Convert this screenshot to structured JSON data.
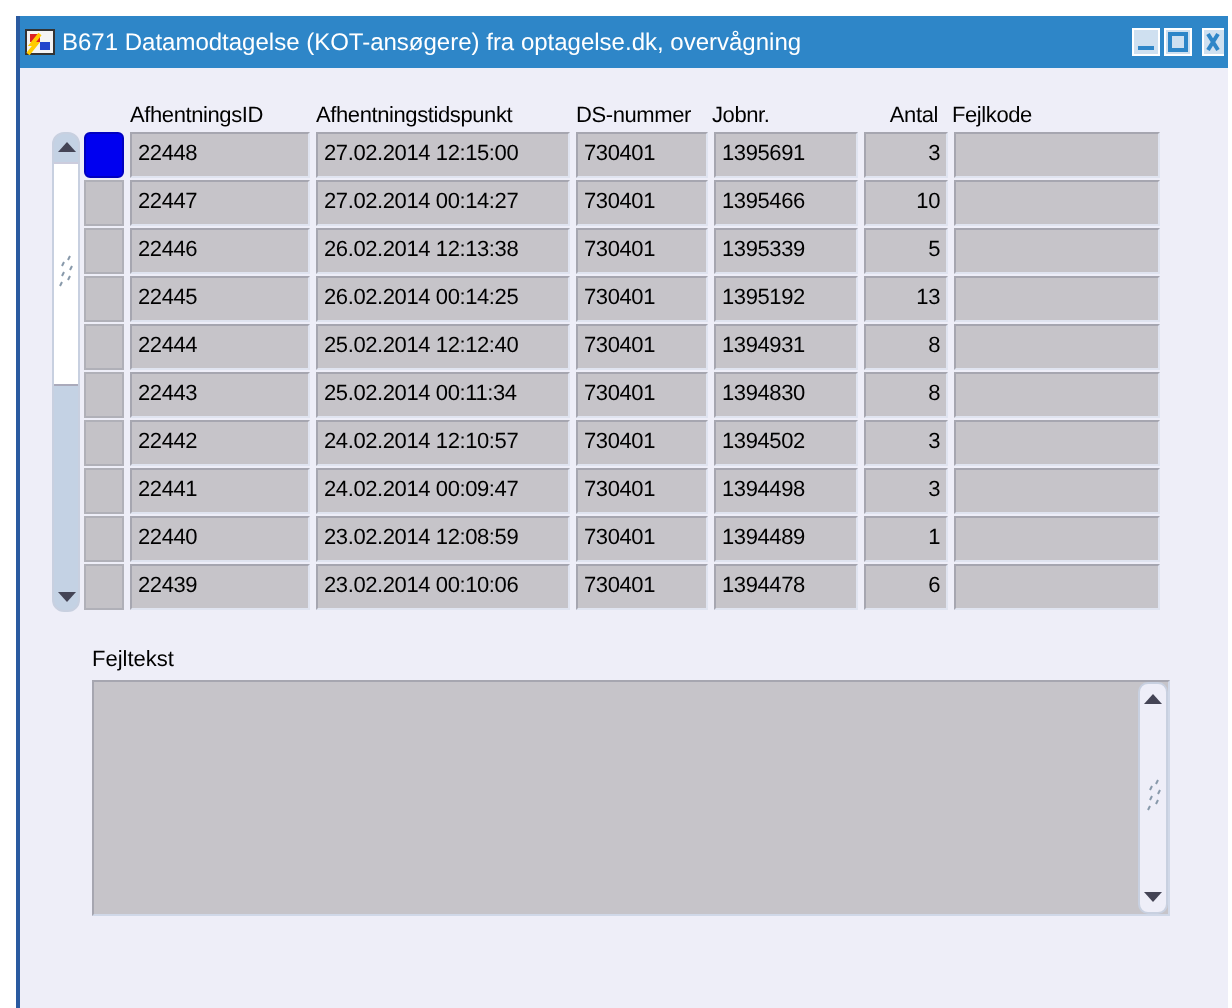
{
  "window": {
    "title": "B671 Datamodtagelse (KOT-ansøgere) fra optagelse.dk, overvågning"
  },
  "table": {
    "columns": [
      {
        "label": "AfhentningsID",
        "kind": "text"
      },
      {
        "label": "Afhentningstidspunkt",
        "kind": "text"
      },
      {
        "label": "DS-nummer",
        "kind": "text"
      },
      {
        "label": "Jobnr.",
        "kind": "text"
      },
      {
        "label": "Antal",
        "kind": "number"
      },
      {
        "label": "Fejlkode",
        "kind": "text"
      }
    ],
    "rows": [
      {
        "selected": true,
        "cells": [
          "22448",
          "27.02.2014 12:15:00",
          "730401",
          "1395691",
          "3"
        ]
      },
      {
        "selected": false,
        "cells": [
          "22447",
          "27.02.2014 00:14:27",
          "730401",
          "1395466",
          "10"
        ]
      },
      {
        "selected": false,
        "cells": [
          "22446",
          "26.02.2014 12:13:38",
          "730401",
          "1395339",
          "5"
        ]
      },
      {
        "selected": false,
        "cells": [
          "22445",
          "26.02.2014 00:14:25",
          "730401",
          "1395192",
          "13"
        ]
      },
      {
        "selected": false,
        "cells": [
          "22444",
          "25.02.2014 12:12:40",
          "730401",
          "1394931",
          "8"
        ]
      },
      {
        "selected": false,
        "cells": [
          "22443",
          "25.02.2014 00:11:34",
          "730401",
          "1394830",
          "8"
        ]
      },
      {
        "selected": false,
        "cells": [
          "22442",
          "24.02.2014 12:10:57",
          "730401",
          "1394502",
          "3"
        ]
      },
      {
        "selected": false,
        "cells": [
          "22441",
          "24.02.2014 00:09:47",
          "730401",
          "1394498",
          "3"
        ]
      },
      {
        "selected": false,
        "cells": [
          "22440",
          "23.02.2014 12:08:59",
          "730401",
          "1394489",
          "1"
        ]
      },
      {
        "selected": false,
        "cells": [
          "22439",
          "23.02.2014 00:10:06",
          "730401",
          "1394478",
          "6"
        ]
      }
    ]
  },
  "error_text": {
    "label": "Fejltekst"
  }
}
